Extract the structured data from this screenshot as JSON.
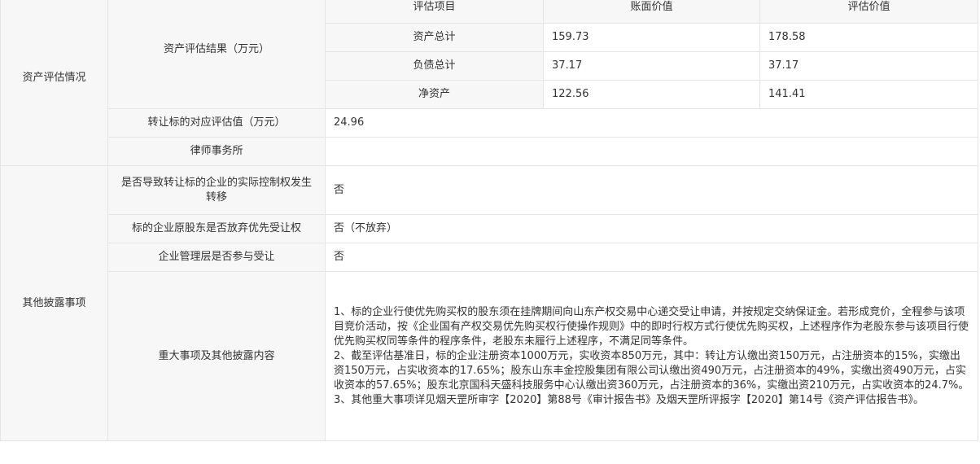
{
  "asset_evaluation": {
    "group_label": "资产评估情况",
    "result_label": "资产评估结果（万元）",
    "columns": [
      "评估项目",
      "账面价值",
      "评估价值"
    ],
    "rows": [
      {
        "item": "资产总计",
        "book": "159.73",
        "eval": "178.58"
      },
      {
        "item": "负债总计",
        "book": "37.17",
        "eval": "37.17"
      },
      {
        "item": "净资产",
        "book": "122.56",
        "eval": "141.41"
      }
    ],
    "target_value_label": "转让标的对应评估值（万元）",
    "target_value": "24.96",
    "law_firm_label": "律师事务所",
    "law_firm_value": ""
  },
  "other_disclosure": {
    "group_label": "其他披露事项",
    "control_transfer_label": "是否导致转让标的企业的实际控制权发生转移",
    "control_transfer_value": "否",
    "waiver_label": "标的企业原股东是否放弃优先受让权",
    "waiver_value": "否（不放弃）",
    "management_label": "企业管理层是否参与受让",
    "management_value": "否",
    "major_items_label": "重大事项及其他披露内容",
    "major_items": [
      "1、标的企业行使优先购买权的股东须在挂牌期间向山东产权交易中心递交受让申请，并按规定交纳保证金。若形成竞价，全程参与该项目竞价活动，按《企业国有产权交易优先购买权行使操作规则》中的即时行权方式行使优先购买权，上述程序作为老股东参与该项目行使优先购买权同等条件的程序条件，老股东未履行上述程序，不满足同等条件。",
      "2、截至评估基准日，标的企业注册资本1000万元，实收资本850万元，其中：转让方认缴出资150万元，占注册资本的15%，实缴出资150万元，占实收资本的17.65%；股东山东丰金控股集团有限公司认缴出资490万元，占注册资本的49%，实缴出资490万元，占实收资本的57.65%；股东北京国科天盛科技服务中心认缴出资360万元，占注册资本的36%，实缴出资210万元，占实收资本的24.7%。",
      "3、其他重大事项详见烟天罡所审字【2020】第88号《审计报告书》及烟天罡所评报字【2020】第14号《资产评估报告书》。"
    ]
  }
}
